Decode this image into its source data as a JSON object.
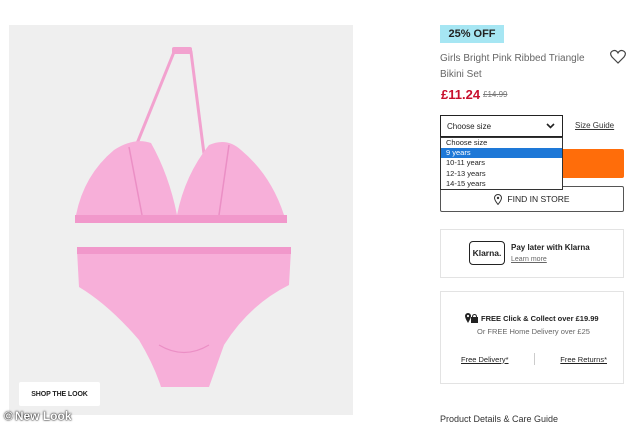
{
  "image": {
    "shop_look_label": "SHOP THE LOOK",
    "watermark": "New Look",
    "bikini_color": "#f6a8d6"
  },
  "product": {
    "badge": "25% OFF",
    "title": "Girls Bright Pink Ribbed Triangle Bikini Set",
    "price": "£11.24",
    "old_price": "£14.99"
  },
  "size": {
    "selected_label": "Choose size",
    "guide_link": "Size Guide",
    "options": [
      "Choose size",
      "9 years",
      "10-11 years",
      "12-13 years",
      "14-15 years"
    ],
    "highlighted_index": 1
  },
  "actions": {
    "find_in_store": "FIND IN STORE",
    "add_button_color": "#ff6d0a"
  },
  "klarna": {
    "logo": "Klarna.",
    "title": "Pay later with Klarna",
    "link": "Learn more"
  },
  "delivery": {
    "title": "FREE Click & Collect over £19.99",
    "subtitle": "Or FREE Home Delivery over £25",
    "link_delivery": "Free Delivery*",
    "link_returns": "Free Returns*"
  },
  "details_heading": "Product Details & Care Guide"
}
